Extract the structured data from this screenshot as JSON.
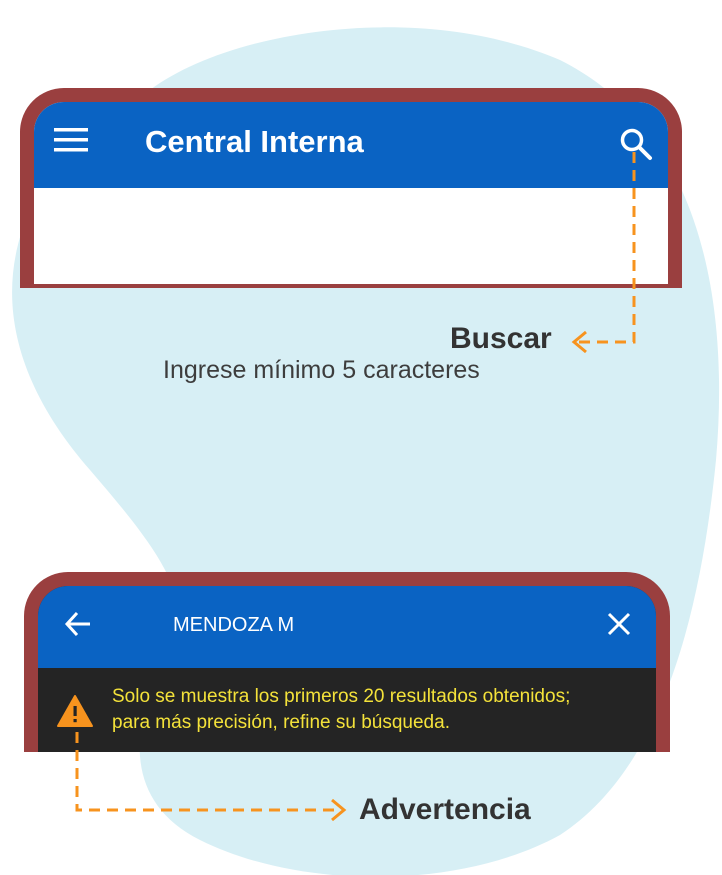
{
  "colors": {
    "blob": "#d7eff5",
    "device_frame": "#9a3f3f",
    "app_bar": "#0a63c3",
    "warning_bg": "#242424",
    "warning_text": "#f4e23a",
    "warning_icon": "#f7931e",
    "callout_line": "#f7931e",
    "callout_title": "#333333"
  },
  "top_screen": {
    "menu_icon": "hamburger-menu-icon",
    "title": "Central Interna",
    "search_icon": "magnifier-search-icon"
  },
  "bottom_screen": {
    "back_icon": "arrow-left-icon",
    "query": "MENDOZA M",
    "close_icon": "x-close-icon",
    "warning_icon": "warning-triangle-icon",
    "warning_line1": "Solo se muestra los primeros 20 resultados obtenidos;",
    "warning_line2": "para más precisión, refine su búsqueda."
  },
  "callouts": {
    "search_title": "Buscar",
    "search_desc": "Ingrese mínimo 5 caracteres",
    "warning_title": "Advertencia"
  }
}
